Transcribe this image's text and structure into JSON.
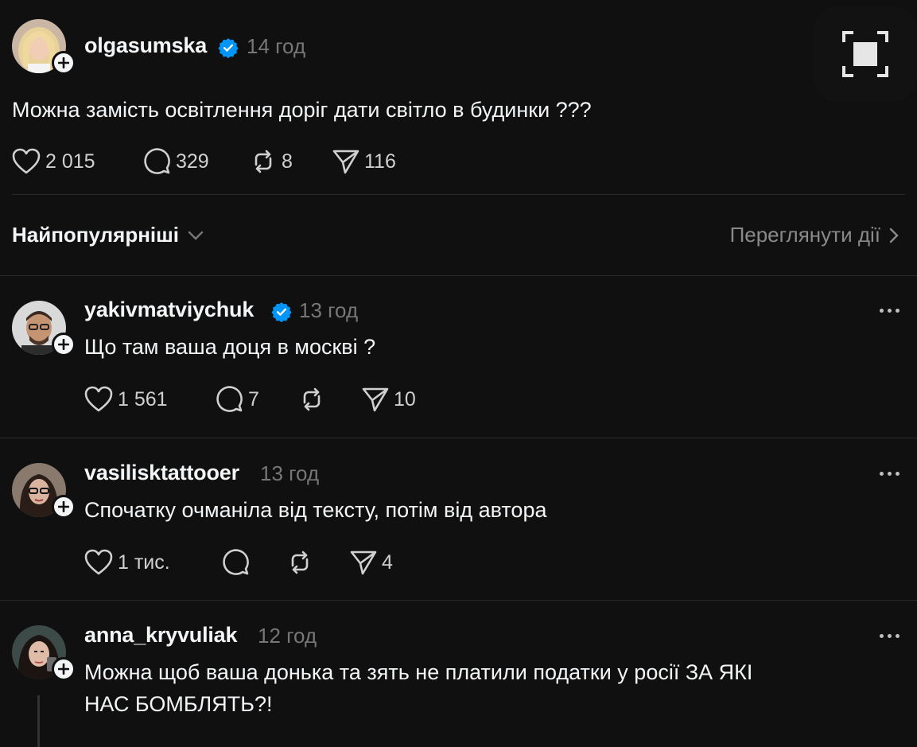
{
  "post": {
    "username": "olgasumska",
    "time": "14 год",
    "text": "Можна замість освітлення доріг дати світло в будинки ???",
    "likes": "2 015",
    "comments": "329",
    "reposts": "8",
    "shares": "116"
  },
  "sort": {
    "label": "Найпопулярніші",
    "view_activity": "Переглянути дії"
  },
  "replies": [
    {
      "username": "yakivmatviychuk",
      "verified": true,
      "time": "13 год",
      "text": "Що там ваша доця в москві ?",
      "likes": "1 561",
      "comments": "7",
      "reposts": "",
      "shares": "10"
    },
    {
      "username": "vasilisktattooer",
      "verified": false,
      "time": "13 год",
      "text": "Спочатку очманіла від тексту, потім від автора",
      "likes": "1 тис.",
      "comments": "",
      "reposts": "",
      "shares": "4"
    },
    {
      "username": "anna_kryvuliak",
      "verified": false,
      "time": "12 год",
      "text_line1": "Можна щоб ваша донька та зять не платили податки у росії ЗА ЯКІ",
      "text_line2": "НАС БОМБЛЯТЬ?!"
    }
  ],
  "colors": {
    "background": "#101010",
    "verified_blue": "#0095f6",
    "muted": "#777777"
  },
  "icons": [
    "heart-icon",
    "comment-icon",
    "repost-icon",
    "share-icon",
    "verified-icon",
    "plus-icon",
    "more-icon",
    "chevron-down-icon",
    "chevron-right-icon",
    "expand-icon"
  ]
}
